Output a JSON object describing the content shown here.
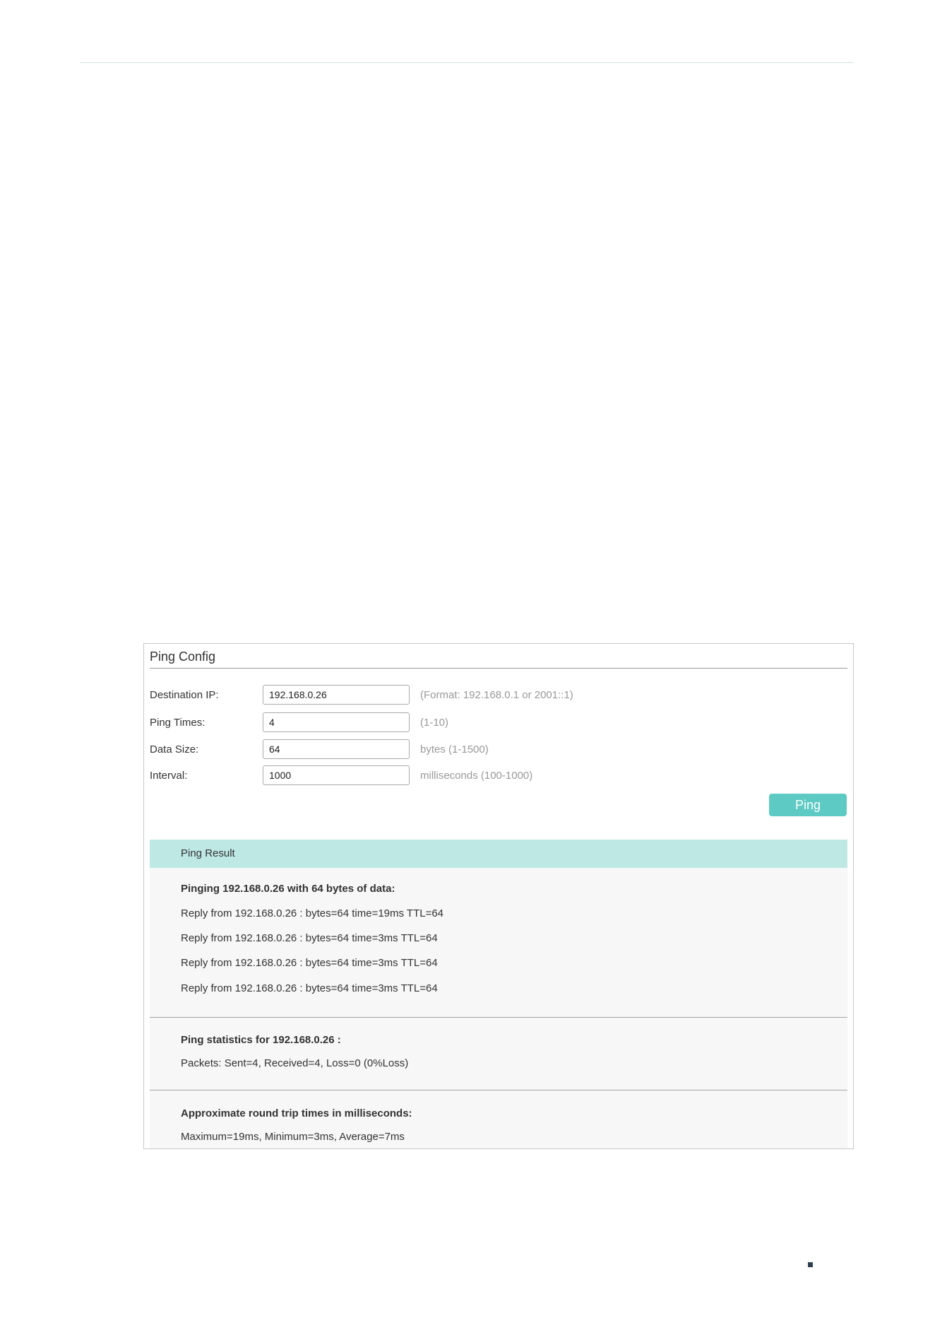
{
  "panel": {
    "title": "Ping Config"
  },
  "form": {
    "fields": [
      {
        "label": "Destination IP:",
        "value": "192.168.0.26",
        "hint": "(Format: 192.168.0.1 or 2001::1)"
      },
      {
        "label": "Ping Times:",
        "value": "4",
        "hint": "(1-10)"
      },
      {
        "label": "Data Size:",
        "value": "64",
        "hint": "bytes (1-1500)"
      },
      {
        "label": "Interval:",
        "value": "1000",
        "hint": "milliseconds (100-1000)"
      }
    ],
    "ping_button_label": "Ping"
  },
  "result": {
    "header": "Ping Result",
    "pinging_heading": "Pinging 192.168.0.26 with 64 bytes of data:",
    "replies": [
      "Reply from 192.168.0.26 : bytes=64 time=19ms TTL=64",
      "Reply from 192.168.0.26 : bytes=64 time=3ms TTL=64",
      "Reply from 192.168.0.26 : bytes=64 time=3ms TTL=64",
      "Reply from 192.168.0.26 : bytes=64 time=3ms TTL=64"
    ],
    "statistics_heading": "Ping statistics for 192.168.0.26 :",
    "statistics_line": "Packets: Sent=4, Received=4, Loss=0 (0%Loss)",
    "rtt_heading": "Approximate round trip times in milliseconds:",
    "rtt_line": "Maximum=19ms, Minimum=3ms, Average=7ms"
  },
  "colors": {
    "accent": "#5dcac4",
    "result_header_bg": "#bde8e4",
    "result_body_bg": "#f7f7f7"
  }
}
